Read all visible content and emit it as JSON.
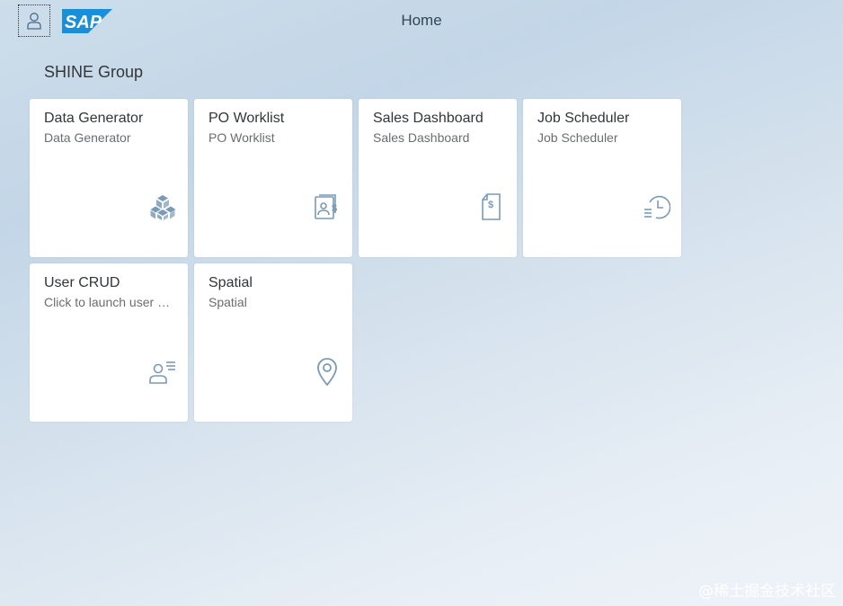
{
  "header": {
    "title": "Home",
    "logo_text": "SAP",
    "logo_color": "#1a8fd8"
  },
  "group": {
    "title": "SHINE Group"
  },
  "tiles": [
    {
      "title": "Data Generator",
      "subtitle": "Data Generator",
      "icon": "cubes-icon"
    },
    {
      "title": "PO Worklist",
      "subtitle": "PO Worklist",
      "icon": "payment-document-icon"
    },
    {
      "title": "Sales Dashboard",
      "subtitle": "Sales Dashboard",
      "icon": "invoice-icon"
    },
    {
      "title": "Job Scheduler",
      "subtitle": "Job Scheduler",
      "icon": "history-icon"
    },
    {
      "title": "User CRUD",
      "subtitle": "Click to launch user CRUD application",
      "icon": "user-list-icon"
    },
    {
      "title": "Spatial",
      "subtitle": "Spatial",
      "icon": "map-pin-icon"
    }
  ],
  "colors": {
    "icon": "#7a9ab5",
    "tile_bg": "#ffffff"
  },
  "watermark": "@稀土掘金技术社区"
}
